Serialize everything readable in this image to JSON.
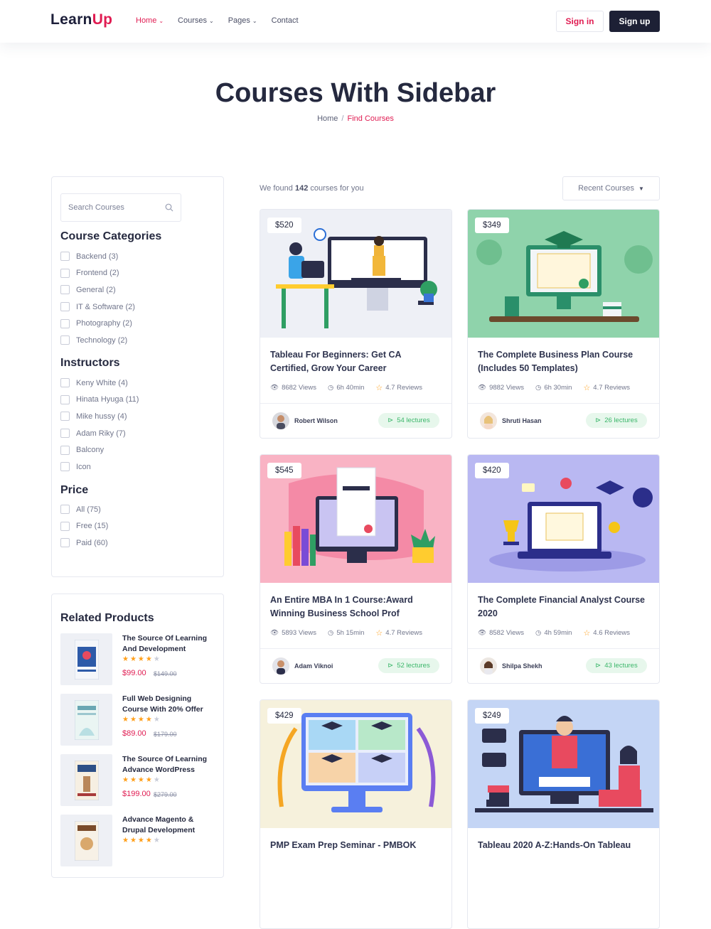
{
  "brand": {
    "part1": "Learn",
    "part2": "Up"
  },
  "nav": [
    {
      "label": "Home",
      "active": true
    },
    {
      "label": "Courses",
      "active": false
    },
    {
      "label": "Pages",
      "active": false
    },
    {
      "label": "Contact",
      "active": false
    }
  ],
  "auth": {
    "signin": "Sign in",
    "signup": "Sign up"
  },
  "hero": {
    "title": "Courses With Sidebar",
    "breadcrumb_home": "Home",
    "breadcrumb_sep": "/",
    "breadcrumb_current": "Find Courses"
  },
  "sidebar": {
    "search_placeholder": "Search Courses",
    "categories_title": "Course Categories",
    "categories": [
      "Backend (3)",
      "Frontend (2)",
      "General (2)",
      "IT & Software (2)",
      "Photography (2)",
      "Technology (2)"
    ],
    "instructors_title": "Instructors",
    "instructors": [
      "Keny White (4)",
      "Hinata Hyuga (11)",
      "Mike hussy (4)",
      "Adam Riky (7)",
      "Balcony",
      "Icon"
    ],
    "price_title": "Price",
    "prices": [
      "All (75)",
      "Free (15)",
      "Paid (60)"
    ]
  },
  "related": {
    "title": "Related Products",
    "items": [
      {
        "name": "The Source Of Learning And Development",
        "price": "$99.00",
        "old": "$149.00",
        "rating": 4
      },
      {
        "name": "Full Web Designing Course With 20% Offer",
        "price": "$89.00",
        "old": "$179.00",
        "rating": 4
      },
      {
        "name": "The Source Of Learning Advance WordPress",
        "price": "$199.00",
        "old": "$279.00",
        "rating": 4
      },
      {
        "name": "Advance Magento & Drupal Development",
        "price": "",
        "old": "",
        "rating": 4
      }
    ]
  },
  "results": {
    "prefix": "We found",
    "count": "142",
    "suffix": "courses for you",
    "sort_label": "Recent Courses"
  },
  "courses": [
    {
      "price": "$520",
      "title": "Tableau For Beginners: Get CA Certified, Grow Your Career",
      "views": "8682 Views",
      "time": "6h 40min",
      "reviews": "4.7 Reviews",
      "instructor": "Robert Wilson",
      "lectures": "54 lectures",
      "bg": "#eef0f6"
    },
    {
      "price": "$349",
      "title": "The Complete Business Plan Course (Includes 50 Templates)",
      "views": "9882 Views",
      "time": "6h 30min",
      "reviews": "4.7 Reviews",
      "instructor": "Shruti Hasan",
      "lectures": "26 lectures",
      "bg": "#8fd3ab"
    },
    {
      "price": "$545",
      "title": "An Entire MBA In 1 Course:Award Winning Business School Prof",
      "views": "5893 Views",
      "time": "5h 15min",
      "reviews": "4.7 Reviews",
      "instructor": "Adam Viknoi",
      "lectures": "52 lectures",
      "bg": "#f9b3c4"
    },
    {
      "price": "$420",
      "title": "The Complete Financial Analyst Course 2020",
      "views": "8582 Views",
      "time": "4h 59min",
      "reviews": "4.6 Reviews",
      "instructor": "Shilpa Shekh",
      "lectures": "43 lectures",
      "bg": "#b9b8f2"
    },
    {
      "price": "$429",
      "title": "PMP Exam Prep Seminar - PMBOK",
      "views": "",
      "time": "",
      "reviews": "",
      "instructor": "",
      "lectures": "",
      "bg": "#f6f1dc"
    },
    {
      "price": "$249",
      "title": "Tableau 2020 A-Z:Hands-On Tableau",
      "views": "",
      "time": "",
      "reviews": "",
      "instructor": "",
      "lectures": "",
      "bg": "#c4d5f5"
    }
  ],
  "colors": {
    "accent": "#e01c52",
    "dark": "#1d2035",
    "success": "#3bb66a",
    "star": "#ff9f1a"
  }
}
